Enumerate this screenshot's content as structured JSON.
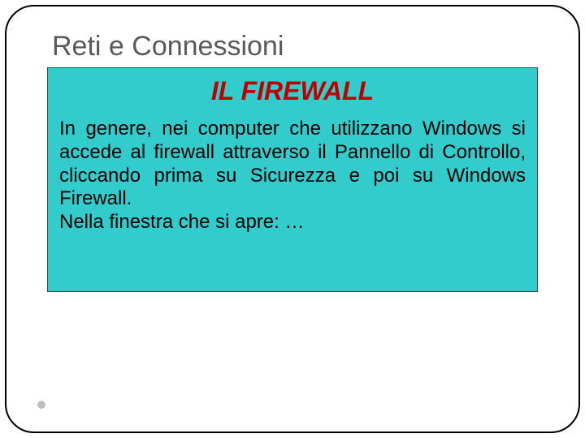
{
  "slide": {
    "heading": "Reti e Connessioni",
    "subtitle": "IL FIREWALL",
    "body": "In genere, nei computer che utilizzano Windows si accede al firewall attraverso il Pannello di Controllo, cliccando prima su Sicurezza e poi su Windows Firewall.\nNella finestra che si apre: …"
  }
}
